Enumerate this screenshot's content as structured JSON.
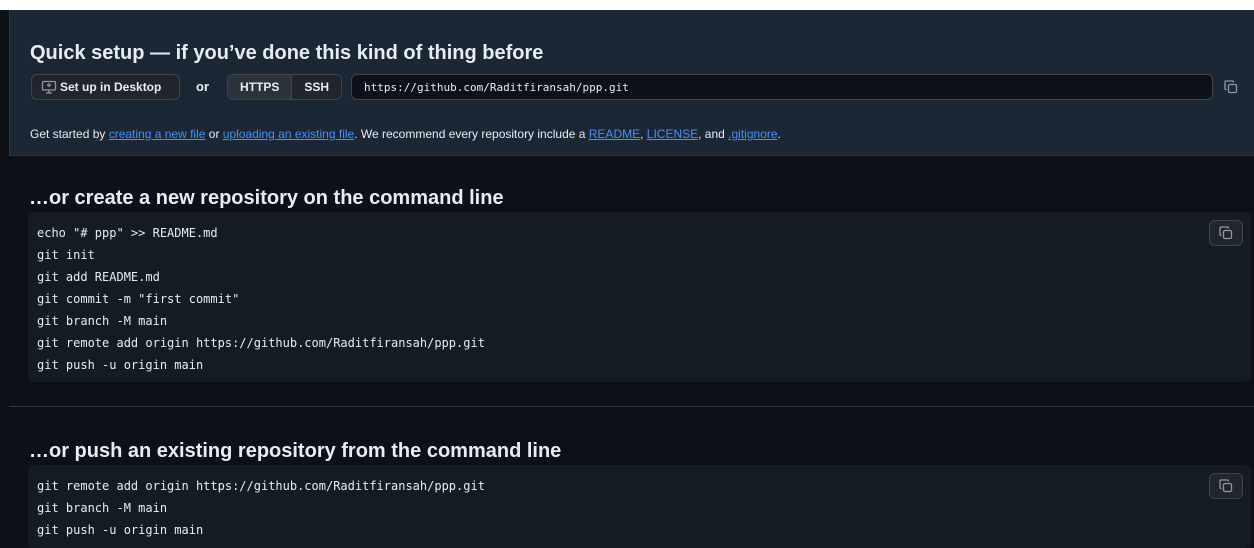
{
  "quick_setup": {
    "title": "Quick setup — if you’ve done this kind of thing before",
    "desktop_button": "Set up in Desktop",
    "or_label": "or",
    "protocols": [
      "HTTPS",
      "SSH"
    ],
    "selected_protocol": "HTTPS",
    "clone_url": "https://github.com/Raditfiransah/ppp.git",
    "get_started": {
      "t1": "Get started by ",
      "link_new_file": "creating a new file",
      "t2": " or ",
      "link_upload": "uploading an existing file",
      "t3": ". We recommend every repository include a ",
      "link_readme": "README",
      "t4": ", ",
      "link_license": "LICENSE",
      "t5": ", and ",
      "link_gitignore": ".gitignore",
      "t6": "."
    }
  },
  "create_section": {
    "title": "…or create a new repository on the command line",
    "commands": [
      "echo \"# ppp\" >> README.md",
      "git init",
      "git add README.md",
      "git commit -m \"first commit\"",
      "git branch -M main",
      "git remote add origin https://github.com/Raditfiransah/ppp.git",
      "git push -u origin main"
    ]
  },
  "push_section": {
    "title": "…or push an existing repository from the command line",
    "commands": [
      "git remote add origin https://github.com/Raditfiransah/ppp.git",
      "git branch -M main",
      "git push -u origin main"
    ]
  },
  "icons": {
    "desktop": "desktop-icon",
    "copy": "copy-icon"
  },
  "colors": {
    "page_bg": "#0d1117",
    "quick_setup_bg": "#1c2736",
    "code_bg": "#151b23",
    "link": "#4493f8",
    "text": "#e6edf3"
  }
}
